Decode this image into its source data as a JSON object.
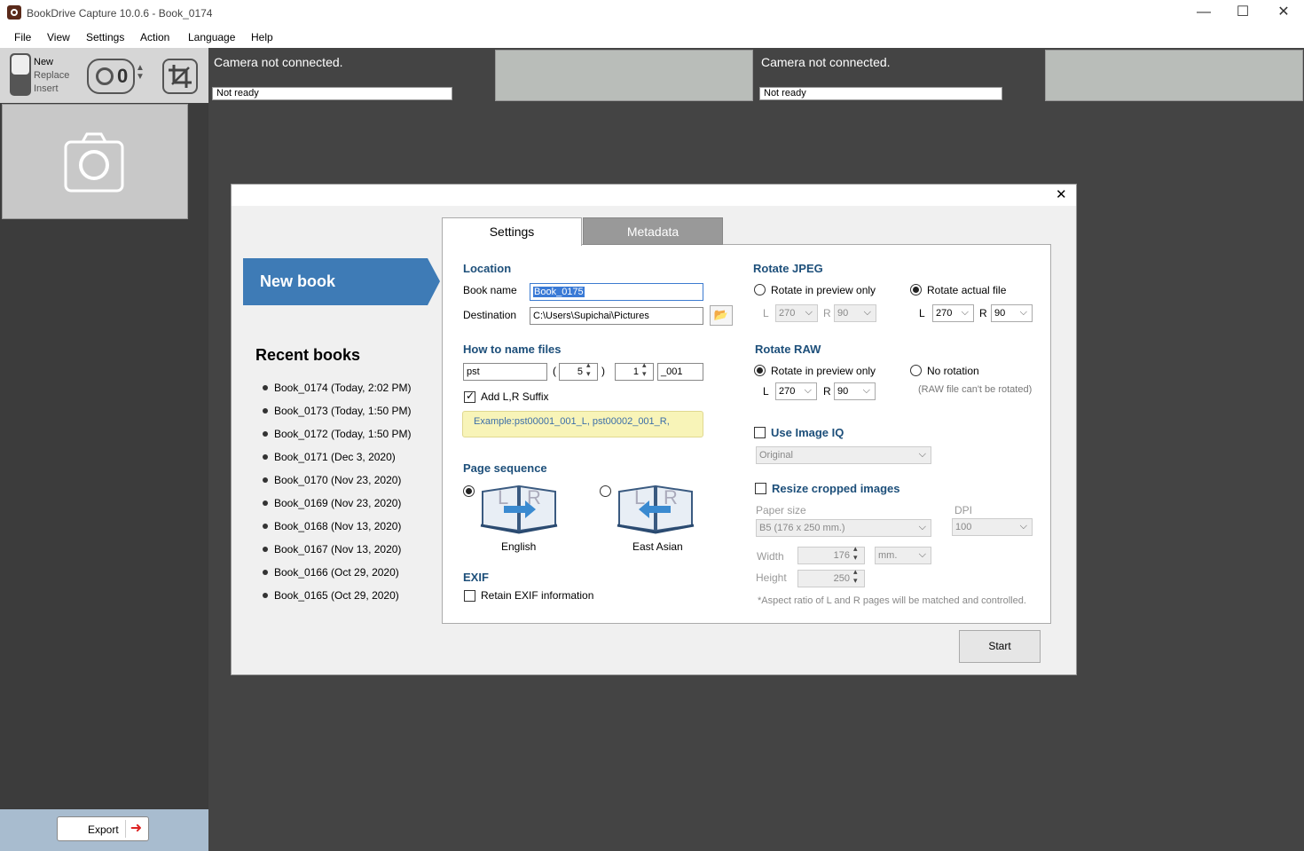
{
  "window": {
    "title": "BookDrive Capture 10.0.6 - Book_0174",
    "min": "—",
    "max": "☐",
    "close": "✕"
  },
  "menu": [
    "File",
    "View",
    "Settings",
    "Action",
    "Language",
    "Help"
  ],
  "toolbar": {
    "modes": [
      "New",
      "Replace",
      "Insert"
    ],
    "timer_value": "0"
  },
  "cameras": [
    {
      "text": "Camera not connected.",
      "status": "Not ready"
    },
    {
      "text": "Camera not connected.",
      "status": "Not ready"
    }
  ],
  "export_label": "Export",
  "dialog": {
    "close": "✕",
    "tabs": [
      "Settings",
      "Metadata"
    ],
    "new_book": "New book",
    "recent_title": "Recent books",
    "recent": [
      "Book_0174 (Today, 2:02 PM)",
      "Book_0173 (Today, 1:50 PM)",
      "Book_0172 (Today, 1:50 PM)",
      "Book_0171 (Dec 3, 2020)",
      "Book_0170 (Nov 23, 2020)",
      "Book_0169 (Nov 23, 2020)",
      "Book_0168 (Nov 13, 2020)",
      "Book_0167 (Nov 13, 2020)",
      "Book_0166 (Oct 29, 2020)",
      "Book_0165 (Oct 29, 2020)"
    ],
    "location": {
      "title": "Location",
      "book_name_label": "Book name",
      "book_name": "Book_0175",
      "destination_label": "Destination",
      "destination": "C:\\Users\\Supichai\\Pictures"
    },
    "naming": {
      "title": "How to name files",
      "prefix": "pst",
      "open_paren": "(",
      "digits": "5",
      "close_paren": ")",
      "start": "1",
      "suffix": "_001",
      "lr_suffix_label": "Add L,R Suffix",
      "example": "Example:pst00001_001_L, pst00002_001_R,"
    },
    "page_sequence": {
      "title": "Page sequence",
      "english": "English",
      "east_asian": "East Asian",
      "letter_l": "L",
      "letter_r": "R"
    },
    "exif": {
      "title": "EXIF",
      "retain_label": "Retain EXIF information"
    },
    "rotate_jpeg": {
      "title": "Rotate JPEG",
      "preview_only": "Rotate in preview only",
      "actual": "Rotate actual file",
      "l": "L",
      "r": "R",
      "preview_l": "270",
      "preview_r": "90",
      "actual_l": "270",
      "actual_r": "90"
    },
    "rotate_raw": {
      "title": "Rotate RAW",
      "preview_only": "Rotate in preview only",
      "none": "No rotation",
      "note": "(RAW file can't be rotated)",
      "l": "L",
      "r": "R",
      "l_val": "270",
      "r_val": "90"
    },
    "image_iq": {
      "title": "Use Image IQ",
      "value": "Original"
    },
    "resize": {
      "title": "Resize cropped images",
      "paper_label": "Paper size",
      "paper": "B5 (176 x 250 mm.)",
      "dpi_label": "DPI",
      "dpi": "100",
      "width_label": "Width",
      "width": "176",
      "height_label": "Height",
      "height": "250",
      "unit": "mm.",
      "note": "*Aspect ratio of L and R pages will be matched and controlled."
    },
    "start": "Start"
  }
}
